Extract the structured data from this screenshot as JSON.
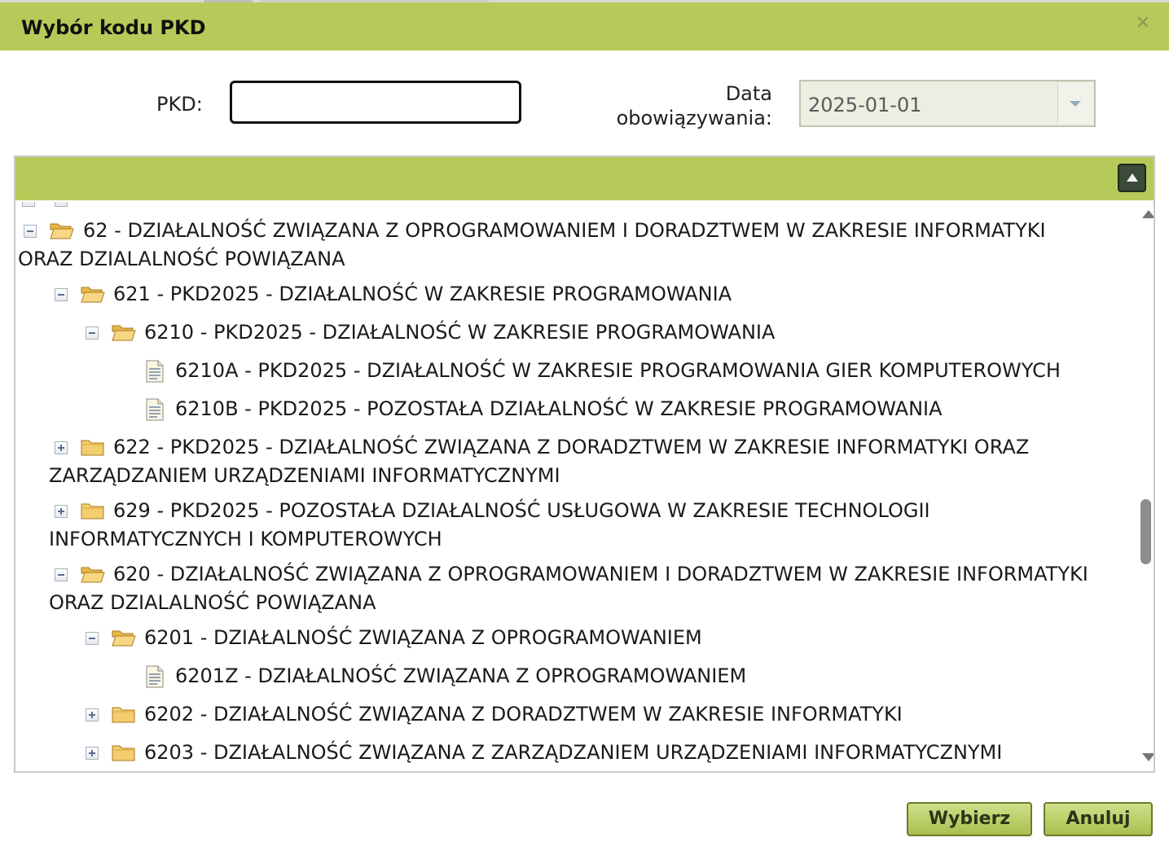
{
  "dialog": {
    "title": "Wybór kodu PKD",
    "close_glyph": "✕",
    "accent": "#b5ca58"
  },
  "filters": {
    "pkd_label": "PKD:",
    "pkd_value": "",
    "date_label": "Data obowiązywania:",
    "date_value": "2025-01-01"
  },
  "tree": {
    "nodes": [
      {
        "code_text": "62 - DZIAŁALNOŚĆ ZWIĄZANA Z OPROGRAMOWANIEM I DORADZTWEM W ZAKRESIE INFORMATYKI ORAZ DZIALALNOŚĆ POWIĄZANA",
        "expanded": true,
        "icon": "folder-open-icon"
      },
      {
        "code_text": "621 - PKD2025 - DZIAŁALNOŚĆ W ZAKRESIE PROGRAMOWANIA",
        "expanded": true,
        "icon": "folder-open-icon"
      },
      {
        "code_text": "6210 - PKD2025 - DZIAŁALNOŚĆ W ZAKRESIE PROGRAMOWANIA",
        "expanded": true,
        "icon": "folder-open-icon"
      },
      {
        "code_text": "6210A - PKD2025 - DZIAŁALNOŚĆ W ZAKRESIE PROGRAMOWANIA GIER KOMPUTEROWYCH",
        "icon": "document-icon"
      },
      {
        "code_text": "6210B - PKD2025 - POZOSTAŁA DZIAŁALNOŚĆ W ZAKRESIE PROGRAMOWANIA",
        "icon": "document-icon"
      },
      {
        "code_text": "622 - PKD2025 - DZIAŁALNOŚĆ ZWIĄZANA Z DORADZTWEM W ZAKRESIE INFORMATYKI ORAZ ZARZĄDZANIEM URZĄDZENIAMI INFORMATYCZNYMI",
        "expanded": false,
        "icon": "folder-icon"
      },
      {
        "code_text": "629 - PKD2025 - POZOSTAŁA DZIAŁALNOŚĆ USŁUGOWA W ZAKRESIE TECHNOLOGII INFORMATYCZNYCH I KOMPUTEROWYCH",
        "expanded": false,
        "icon": "folder-icon"
      },
      {
        "code_text": "620 - DZIAŁALNOŚĆ ZWIĄZANA Z OPROGRAMOWANIEM I DORADZTWEM W ZAKRESIE INFORMATYKI ORAZ DZIALALNOŚĆ POWIĄZANA",
        "expanded": true,
        "icon": "folder-open-icon"
      },
      {
        "code_text": "6201 - DZIAŁALNOŚĆ ZWIĄZANA Z OPROGRAMOWANIEM",
        "expanded": true,
        "icon": "folder-open-icon"
      },
      {
        "code_text": "6201Z - DZIAŁALNOŚĆ ZWIĄZANA Z OPROGRAMOWANIEM",
        "icon": "document-icon"
      },
      {
        "code_text": "6202 - DZIAŁALNOŚĆ ZWIĄZANA Z DORADZTWEM W ZAKRESIE INFORMATYKI",
        "expanded": false,
        "icon": "folder-icon"
      },
      {
        "code_text": "6203 - DZIAŁALNOŚĆ ZWIĄZANA Z ZARZĄDZANIEM URZĄDZENIAMI INFORMATYCZNYMI",
        "expanded": false,
        "icon": "folder-icon"
      }
    ]
  },
  "buttons": {
    "select_label": "Wybierz",
    "cancel_label": "Anuluj"
  }
}
